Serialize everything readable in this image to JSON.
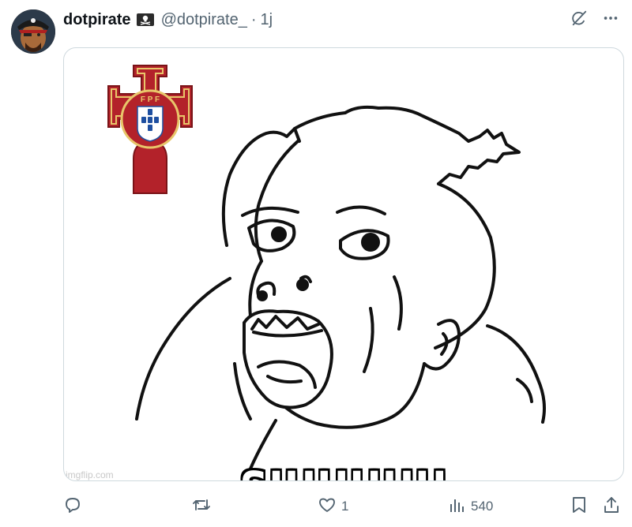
{
  "post": {
    "author_name": "dotpirate",
    "author_handle": "@dotpirate_",
    "separator": "·",
    "time": "1j"
  },
  "media": {
    "caption": "SIUUUUU",
    "watermark": "imgflip.com",
    "crest_letters": "F P F"
  },
  "actions": {
    "reply_count": "",
    "repost_count": "",
    "like_count": "1",
    "views_count": "540"
  },
  "colors": {
    "text_primary": "#0f1419",
    "text_secondary": "#536471",
    "border": "#cfd9de",
    "crest_red": "#b3222a",
    "crest_blue": "#1e4fa0"
  },
  "icons": {
    "badge": "pirate-flag-icon",
    "grok": "grok-icon",
    "more": "more-icon",
    "reply": "reply-icon",
    "repost": "repost-icon",
    "like": "heart-icon",
    "views": "views-icon",
    "bookmark": "bookmark-icon",
    "share": "share-icon"
  }
}
